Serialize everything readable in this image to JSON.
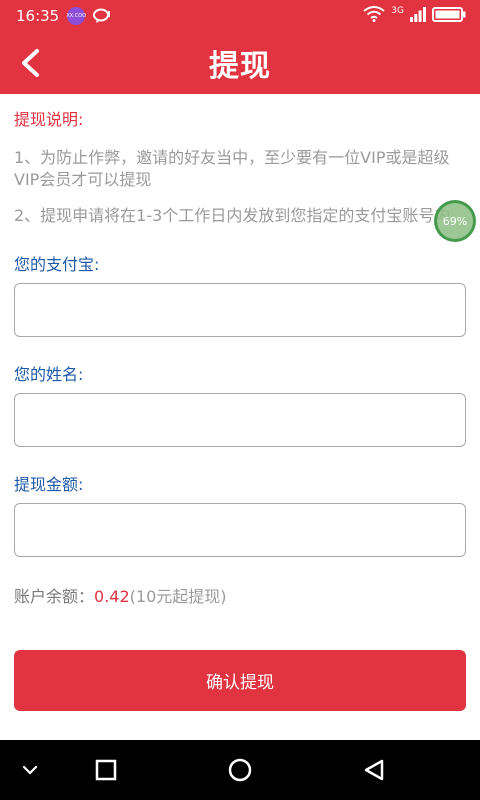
{
  "status_bar": {
    "time": "16:35",
    "badge_text": "XX.COO",
    "network": "3G"
  },
  "header": {
    "title": "提现",
    "back_icon": "chevron-left-icon"
  },
  "notice": {
    "title": "提现说明:",
    "items": [
      "1、为防止作弊，邀请的好友当中，至少要有一位VIP或是超级VIP会员才可以提现",
      "2、提现申请将在1-3个工作日内发放到您指定的支付宝账号内"
    ]
  },
  "form": {
    "alipay_label": "您的支付宝:",
    "alipay_value": "",
    "name_label": "您的姓名:",
    "name_value": "",
    "amount_label": "提现金额:",
    "amount_value": ""
  },
  "balance": {
    "label": "账户余额：",
    "value": "0.42",
    "note": "(10元起提现)"
  },
  "confirm_button": "确认提现",
  "float_badge": "69%",
  "colors": {
    "primary": "#e13340",
    "label_blue": "#1e5aa8",
    "muted": "#9a9a9a"
  }
}
